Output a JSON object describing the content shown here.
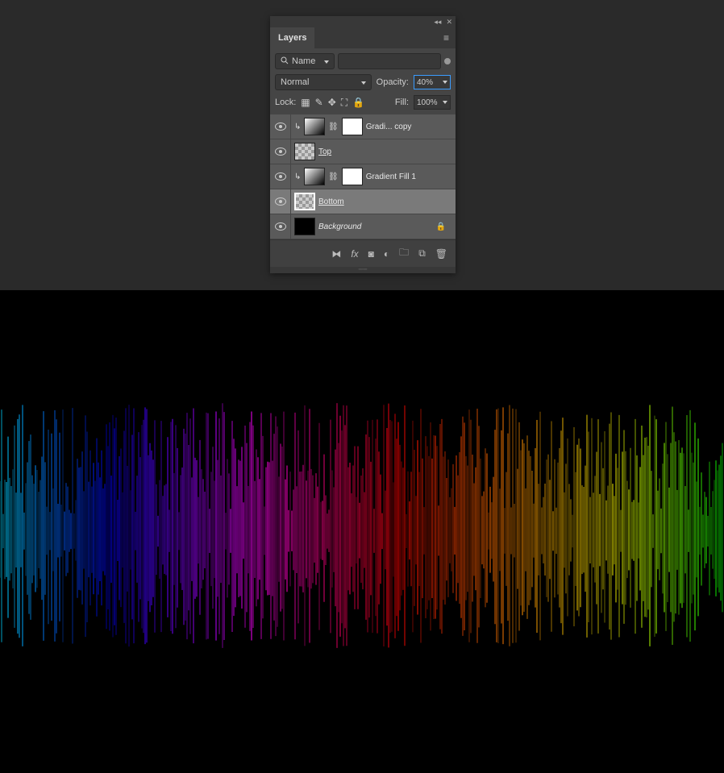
{
  "panel": {
    "title": "Layers",
    "filter_type": "Name",
    "blend_mode": "Normal",
    "opacity_label": "Opacity:",
    "opacity_value": "40%",
    "lock_label": "Lock:",
    "fill_label": "Fill:",
    "fill_value": "100%"
  },
  "layers": [
    {
      "name": "Gradi... copy",
      "clipped": true,
      "type": "gradient",
      "mask": true,
      "selected": false,
      "underline": false,
      "italic": false,
      "locked": false
    },
    {
      "name": "Top",
      "clipped": false,
      "type": "checker",
      "mask": false,
      "selected": false,
      "underline": true,
      "italic": false,
      "locked": false
    },
    {
      "name": "Gradient Fill 1",
      "clipped": true,
      "type": "gradient",
      "mask": true,
      "selected": false,
      "underline": false,
      "italic": false,
      "locked": false
    },
    {
      "name": "Bottom",
      "clipped": false,
      "type": "checker",
      "mask": false,
      "selected": true,
      "underline": true,
      "italic": false,
      "locked": false
    },
    {
      "name": "Background",
      "clipped": false,
      "type": "solid",
      "mask": false,
      "selected": false,
      "underline": false,
      "italic": true,
      "locked": true
    }
  ]
}
